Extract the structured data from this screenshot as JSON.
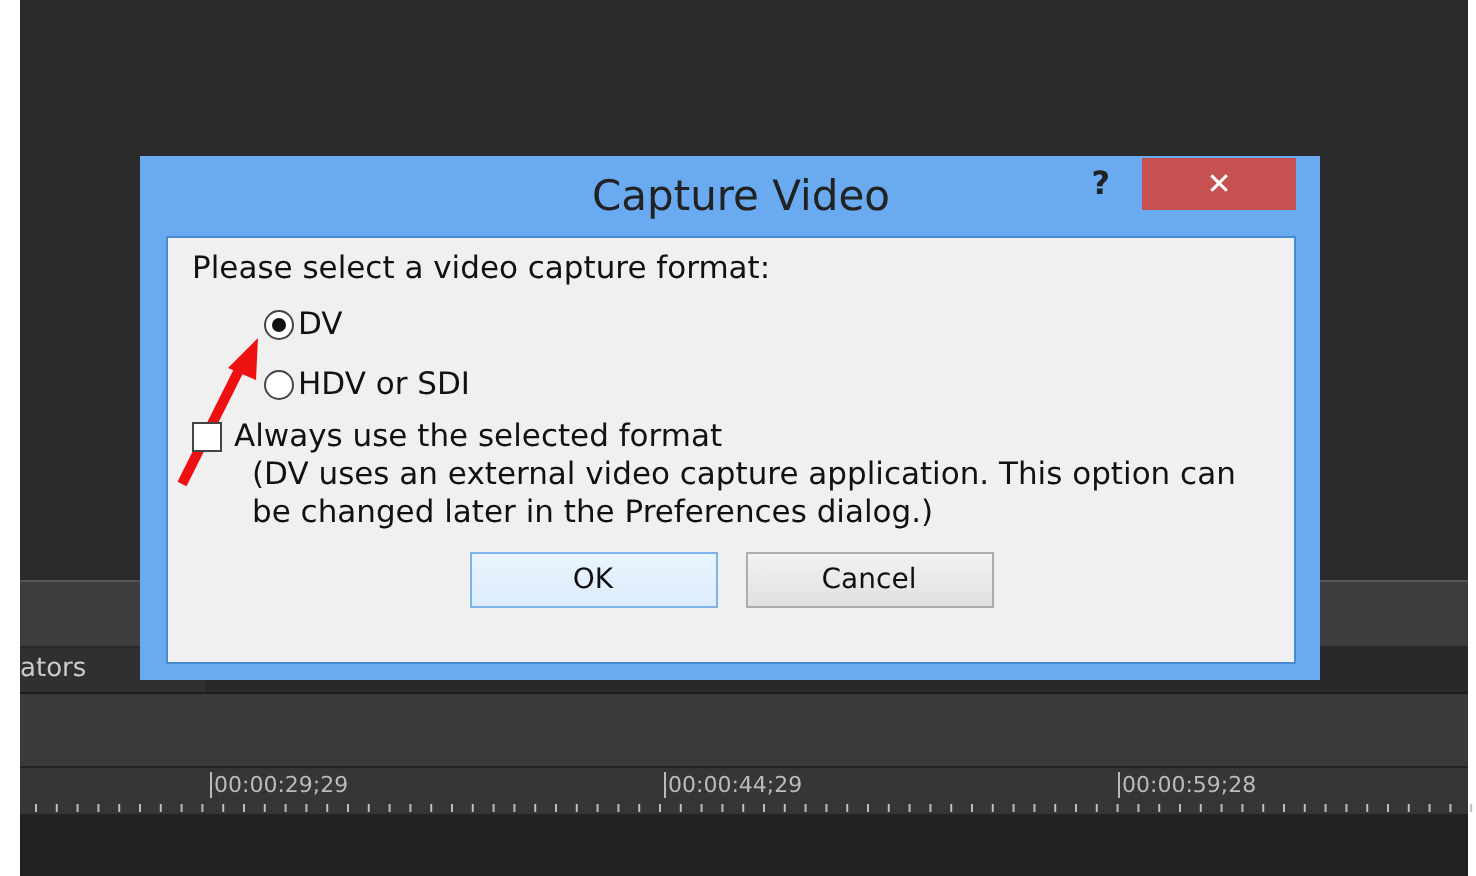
{
  "background": {
    "panel_tab": "ators",
    "ruler_labels": [
      "00:00:29;29",
      "00:00:44;29",
      "00:00:59;28"
    ]
  },
  "dialog": {
    "title": "Capture Video",
    "help": "?",
    "close": "✕",
    "prompt": "Please select a video capture format:",
    "options": [
      {
        "label": "DV",
        "selected": true
      },
      {
        "label": "HDV or SDI",
        "selected": false
      }
    ],
    "checkbox": {
      "label": "Always use the selected format",
      "checked": false
    },
    "note": "(DV uses an external video capture application. This option can be changed later in the Preferences dialog.)",
    "buttons": [
      {
        "label": "OK",
        "kind": "default"
      },
      {
        "label": "Cancel",
        "kind": "normal"
      }
    ]
  }
}
